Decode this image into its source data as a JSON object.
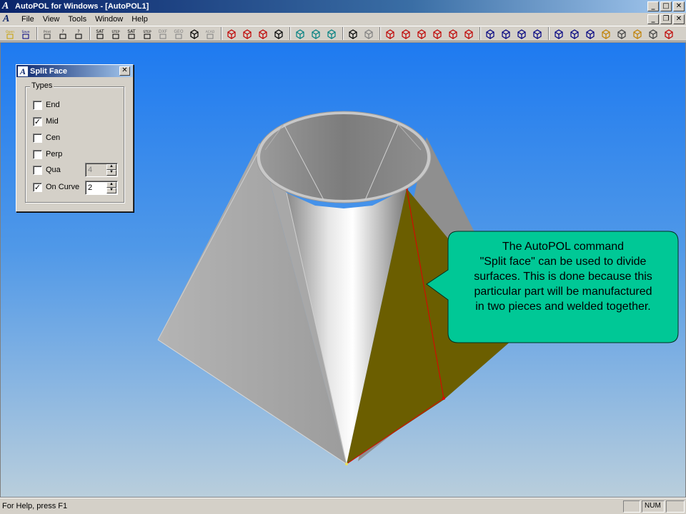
{
  "window": {
    "title": "AutoPOL for Windows - [AutoPOL1]",
    "app_icon": "A",
    "controls": {
      "minimize": "_",
      "maximize": "□",
      "close": "✕"
    },
    "doc_controls": {
      "minimize": "_",
      "restore": "❐",
      "close": "✕"
    }
  },
  "menu": {
    "items": [
      {
        "label": "File"
      },
      {
        "label": "View"
      },
      {
        "label": "Tools"
      },
      {
        "label": "Window"
      },
      {
        "label": "Help"
      }
    ]
  },
  "toolbar": {
    "buttons": [
      {
        "name": "open-icon",
        "label": "Open",
        "color": "#c8a000"
      },
      {
        "name": "save-icon",
        "label": "Save",
        "color": "#000080"
      },
      {
        "name": "print-icon",
        "label": "Print",
        "color": "#404040"
      },
      {
        "name": "help-icon",
        "label": "?",
        "color": "#000"
      },
      {
        "name": "context-help-icon",
        "label": "?",
        "color": "#000"
      },
      {
        "name": "sat-import-icon",
        "label": "SAT",
        "color": "#000"
      },
      {
        "name": "step-import-icon",
        "label": "STEP",
        "color": "#000"
      },
      {
        "name": "sat-export-icon",
        "label": "SAT",
        "color": "#000"
      },
      {
        "name": "step-export-icon",
        "label": "STEP",
        "color": "#000"
      },
      {
        "name": "dxf-export-icon",
        "label": "DXF",
        "color": "#808080"
      },
      {
        "name": "geo-export-icon",
        "label": "GEO",
        "color": "#808080"
      },
      {
        "name": "grid-icon",
        "label": "",
        "color": "#000"
      },
      {
        "name": "acad-link-icon",
        "label": "ACAD LINK",
        "color": "#808080"
      },
      {
        "name": "zoom-window-icon",
        "label": "",
        "color": "#c00000"
      },
      {
        "name": "zoom-in-icon",
        "label": "",
        "color": "#c00000"
      },
      {
        "name": "zoom-all-icon",
        "label": "",
        "color": "#c00000"
      },
      {
        "name": "pan-icon",
        "label": "",
        "color": "#000"
      },
      {
        "name": "shaded-box-icon",
        "label": "",
        "color": "#008080"
      },
      {
        "name": "shaded-box-2-icon",
        "label": "",
        "color": "#008080"
      },
      {
        "name": "shaded-box-3-icon",
        "label": "",
        "color": "#008080"
      },
      {
        "name": "select-icon",
        "label": "",
        "color": "#000"
      },
      {
        "name": "select-2-icon",
        "label": "",
        "color": "#808080"
      },
      {
        "name": "red-cube-1-icon",
        "label": "",
        "color": "#c00000"
      },
      {
        "name": "red-cube-2-icon",
        "label": "",
        "color": "#c00000"
      },
      {
        "name": "red-cube-3-icon",
        "label": "",
        "color": "#c00000"
      },
      {
        "name": "red-cube-4-icon",
        "label": "",
        "color": "#c00000"
      },
      {
        "name": "red-cube-5-icon",
        "label": "",
        "color": "#c00000"
      },
      {
        "name": "red-cube-6-icon",
        "label": "",
        "color": "#c00000"
      },
      {
        "name": "blue-solid-1-icon",
        "label": "",
        "color": "#000080"
      },
      {
        "name": "blue-solid-2-icon",
        "label": "",
        "color": "#000080"
      },
      {
        "name": "blue-solid-3-icon",
        "label": "",
        "color": "#000080"
      },
      {
        "name": "blue-solid-4-icon",
        "label": "",
        "color": "#000080"
      },
      {
        "name": "measure-icon",
        "label": "",
        "color": "#000080"
      },
      {
        "name": "move-icon",
        "label": "",
        "color": "#000080"
      },
      {
        "name": "view-icon",
        "label": "",
        "color": "#000080"
      },
      {
        "name": "pencil-icon",
        "label": "",
        "color": "#c08000"
      },
      {
        "name": "list-icon",
        "label": "",
        "color": "#404040"
      },
      {
        "name": "ruler-icon",
        "label": "",
        "color": "#c08000"
      },
      {
        "name": "tools-icon",
        "label": "",
        "color": "#404040"
      },
      {
        "name": "split-icon",
        "label": "",
        "color": "#c00000"
      }
    ]
  },
  "dialog": {
    "title": "Split Face",
    "close": "✕",
    "group_label": "Types",
    "options": [
      {
        "label": "End",
        "checked": false
      },
      {
        "label": "Mid",
        "checked": true
      },
      {
        "label": "Cen",
        "checked": false
      },
      {
        "label": "Perp",
        "checked": false
      },
      {
        "label": "Qua",
        "checked": false
      },
      {
        "label": "On Curve",
        "checked": true
      }
    ],
    "qua_value": "4",
    "on_curve_value": "2",
    "check_mark": "✓",
    "spin_up": "▲",
    "spin_down": "▼"
  },
  "callout": {
    "lines": [
      "The AutoPOL command",
      "\"Split face\" can be used to divide",
      "surfaces. This is done because this",
      "particular part will be manufactured",
      "in two pieces and welded together."
    ],
    "fill": "#00c896"
  },
  "statusbar": {
    "text": "For Help, press F1",
    "num": "NUM"
  },
  "colors": {
    "surface_split": "#6b5e00",
    "edge_highlight": "#e00000",
    "canvas_top": "#1e7af0"
  }
}
